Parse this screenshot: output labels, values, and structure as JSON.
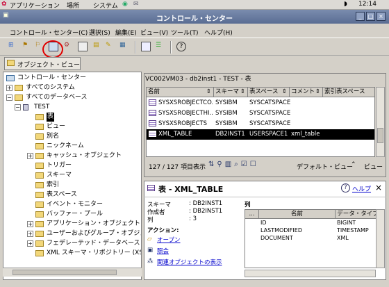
{
  "system_panel": {
    "applications": "アプリケーション",
    "places": "場所",
    "system": "システム",
    "clock": "12:14"
  },
  "window": {
    "title": "コントロール・センター"
  },
  "menu": [
    "コントロール・センター(C)",
    "選択(S)",
    "編集(E)",
    "ビュー(V)",
    "ツール(T)",
    "ヘルプ(H)"
  ],
  "object_view_tab": "オブジェクト・ビュー",
  "tree": [
    "コントロール・センター",
    "すべてのシステム",
    "すべてのデータベース",
    "TEST",
    "表",
    "ビュー",
    "別名",
    "ニックネーム",
    "キャッシュ・オブジェクト",
    "トリガー",
    "スキーマ",
    "索引",
    "表スペース",
    "イベント・モニター",
    "バッファー・プール",
    "アプリケーション・オブジェクト",
    "ユーザーおよびグループ・オブジェク",
    "フェデレーテッド・データベース・",
    "XML スキーマ・リポジトリー (XSR"
  ],
  "contents": {
    "path": "VC002VM03 - db2inst1 - TEST - 表",
    "columns": [
      "名前",
      "スキーマ",
      "表スペース",
      "コメント",
      "索引表スペース"
    ],
    "rows": [
      [
        "SYSXSROBJECTCO...",
        "SYSIBM",
        "SYSCATSPACE",
        ""
      ],
      [
        "SYSXSROBJECTHI...",
        "SYSIBM",
        "SYSCATSPACE",
        ""
      ],
      [
        "SYSXSROBJECTS",
        "SYSIBM",
        "SYSCATSPACE",
        ""
      ],
      [
        "XML_TABLE",
        "DB2INST1",
        "USERSPACE1",
        "xml_table"
      ]
    ],
    "count": "127 / 127 項目表示",
    "default_view": "デフォルト・ビュー",
    "view_short": "ビュー"
  },
  "details": {
    "title": "表 - XML_TABLE",
    "help": "ヘルプ",
    "schema_label": "スキーマ",
    "schema_value": ": DB2INST1",
    "creator_label": "作成者",
    "creator_value": ": DB2INST1",
    "columns_label": "列",
    "columns_value": ": 3",
    "actions_label": "アクション:",
    "action_open": "オープン",
    "action_query": "照会",
    "action_related": "関連オブジェクトの表示",
    "col_section_label": "列",
    "col_headers": [
      "...",
      "名前",
      "データ・タイプ"
    ],
    "col_rows": [
      [
        "ID",
        "BIGINT"
      ],
      [
        "LASTMODIFIED",
        "TIMESTAMP"
      ],
      [
        "DOCUMENT",
        "XML"
      ]
    ]
  },
  "colors": {
    "titlebar": "#5a6d93",
    "selection": "#000000",
    "highlight_circle": "#e00000"
  }
}
